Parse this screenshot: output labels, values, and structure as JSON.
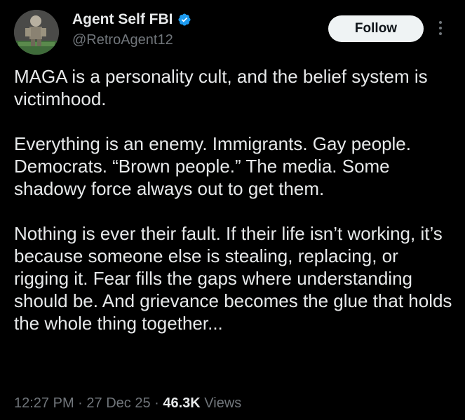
{
  "author": {
    "display_name": "Agent Self FBI",
    "handle": "@RetroAgent12",
    "verified": true
  },
  "actions": {
    "follow_label": "Follow",
    "more_icon": "more-vertical-icon"
  },
  "tweet": {
    "paragraphs": [
      "MAGA is a personality cult, and the belief system is victimhood.",
      "Everything is an enemy. Immigrants. Gay people. Democrats. “Brown people.” The media. Some shadowy force always out to get them.",
      "Nothing is ever their fault. If their life isn’t working, it’s because someone else is stealing, replacing, or rigging it. Fear fills the gaps where understanding should be. And grievance becomes the glue that holds the whole thing together..."
    ]
  },
  "meta": {
    "time": "12:27 PM",
    "sep1": " · ",
    "date": "27 Dec 25",
    "sep2": " · ",
    "views_count": "46.3K",
    "views_label": " Views"
  },
  "colors": {
    "background": "#000000",
    "text": "#e7e9ea",
    "secondary": "#71767b",
    "verified_badge": "#1d9bf0"
  }
}
